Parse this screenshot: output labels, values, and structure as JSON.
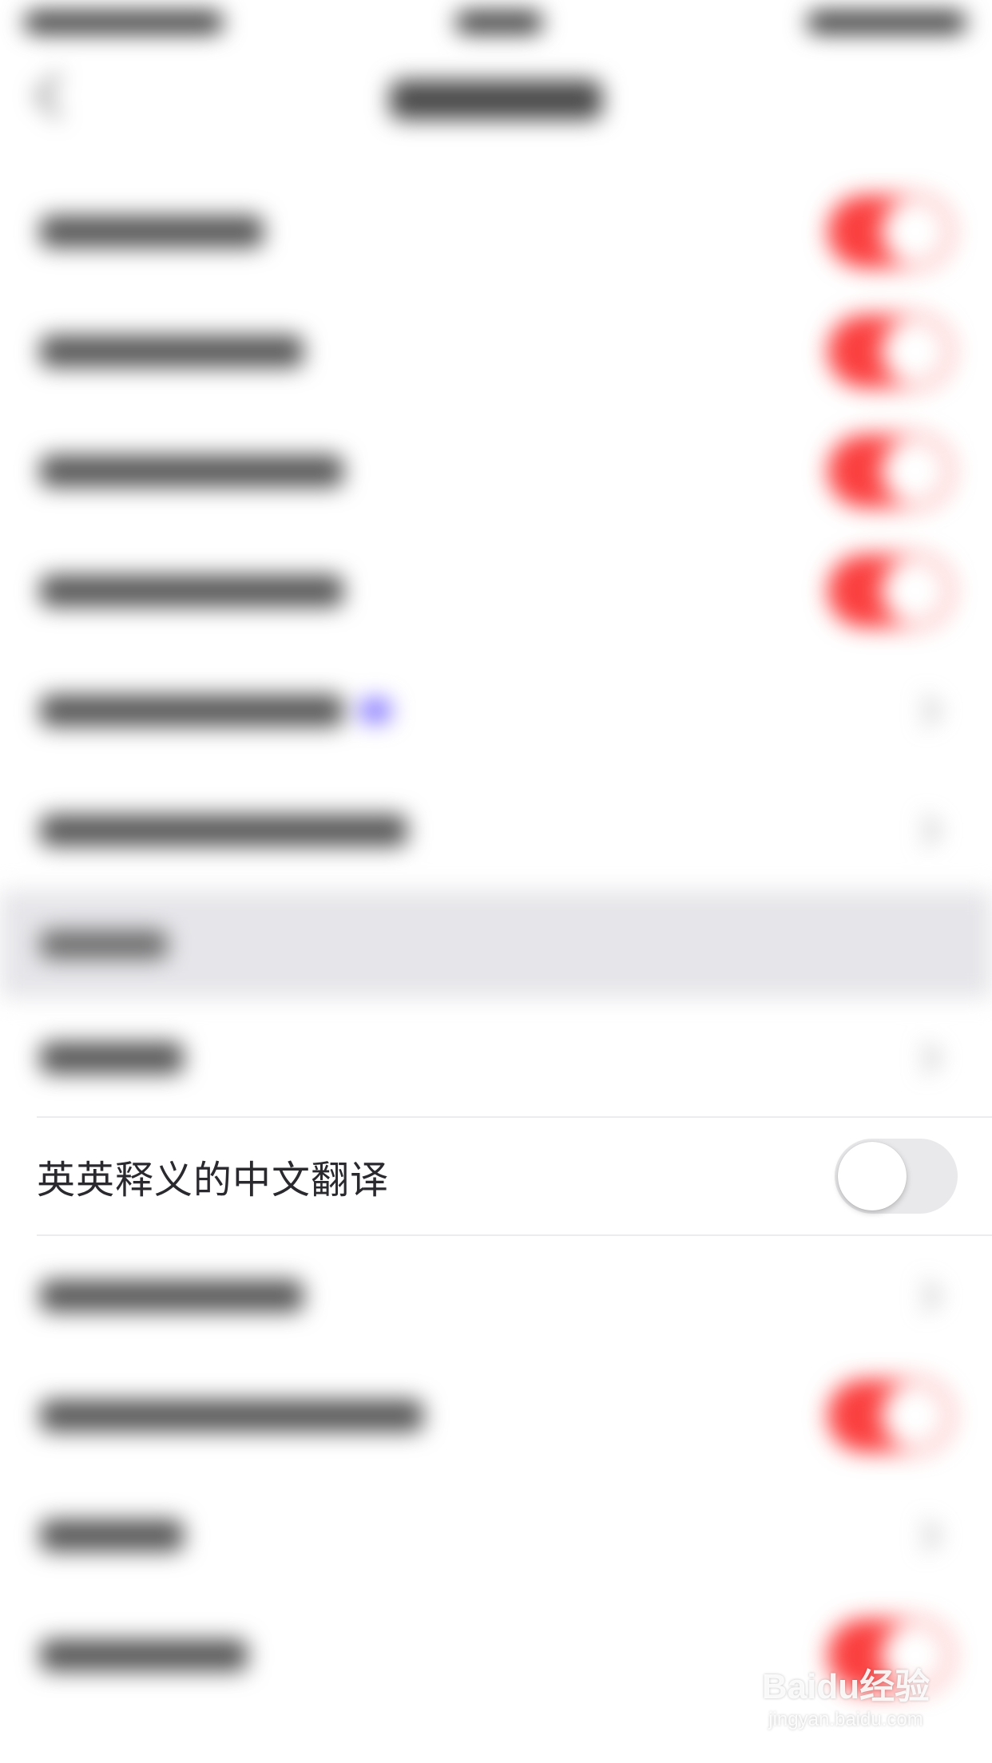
{
  "setting_row": {
    "label": "英英释义的中文翻译",
    "toggle_state": "off"
  },
  "watermark": {
    "logo": "Baidu经验",
    "url": "jingyan.baidu.com"
  },
  "colors": {
    "toggle_on": "#fb3f3f",
    "toggle_off_track": "#e9e9eb",
    "section_header_bg": "#e6e6ea",
    "label_text": "#2a2a2e"
  }
}
